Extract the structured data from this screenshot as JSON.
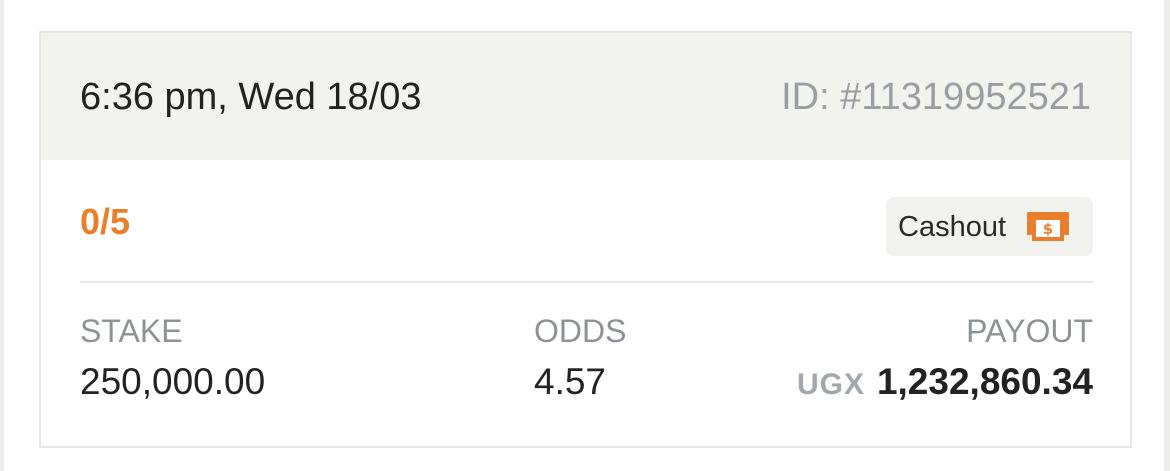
{
  "bet": {
    "datetime": "6:36 pm, Wed 18/03",
    "id": "ID: #11319952521",
    "progress": "0/5",
    "cashout_label": "Cashout",
    "cashout_icon": "cashout-money-icon",
    "accent_color": "#e97f2b",
    "stake": {
      "label": "STAKE",
      "value": "250,000.00"
    },
    "odds": {
      "label": "ODDS",
      "value": "4.57"
    },
    "payout": {
      "label": "PAYOUT",
      "currency": "UGX",
      "value": "1,232,860.34"
    }
  }
}
